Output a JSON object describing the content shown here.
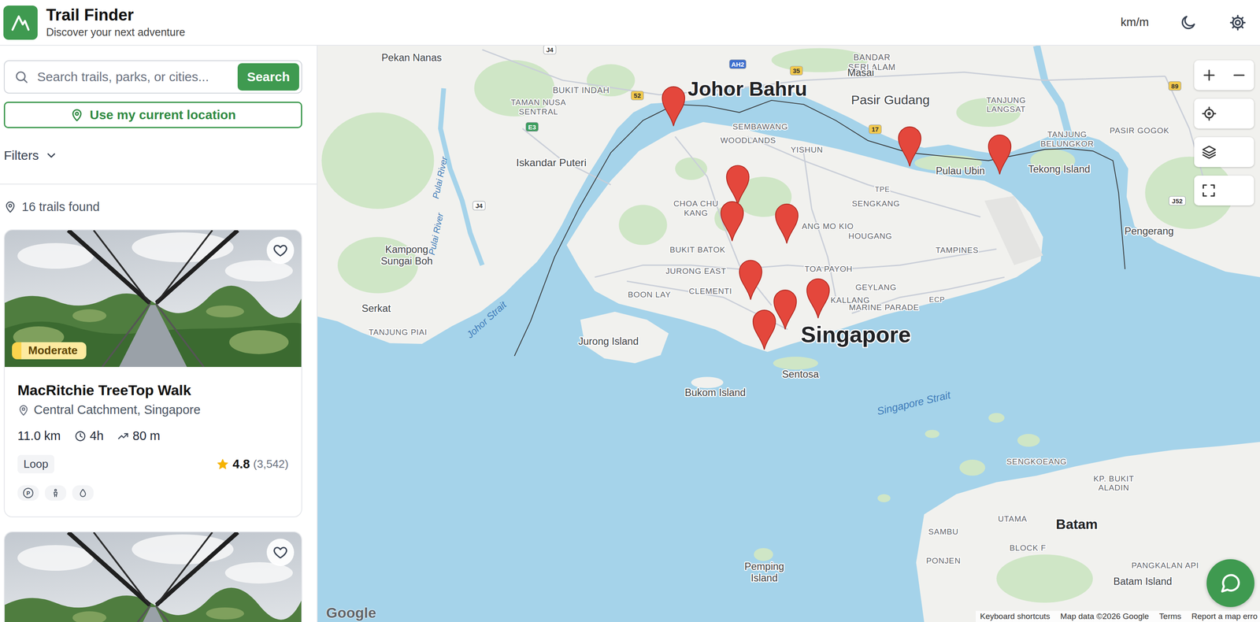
{
  "app": {
    "title": "Trail Finder",
    "subtitle": "Discover your next adventure"
  },
  "header": {
    "units": "km/m"
  },
  "search": {
    "placeholder": "Search trails, parks, or cities...",
    "button": "Search"
  },
  "location_button": "Use my current location",
  "filters": {
    "label": "Filters",
    "expanded": false
  },
  "results": {
    "count": "16 trails found"
  },
  "trails": [
    {
      "difficulty": "Moderate",
      "favorite": false,
      "name": "MacRitchie TreeTop Walk",
      "location": "Central Catchment, Singapore",
      "distance": "11.0 km",
      "duration": "4h",
      "elevation": "80 m",
      "type": "Loop",
      "rating": "4.8",
      "reviews": "(3,542)",
      "amenities": [
        {
          "kind": "parking",
          "label": "P"
        },
        {
          "kind": "restroom"
        },
        {
          "kind": "water"
        }
      ]
    },
    {
      "favorite": false
    }
  ],
  "map": {
    "labels": [
      {
        "lines": [
          "Pekan Nanas"
        ],
        "kind": "town"
      },
      {
        "lines": [
          "BUKIT INDAH"
        ],
        "kind": "district"
      },
      {
        "lines": [
          "Johor Bahru"
        ],
        "kind": "city"
      },
      {
        "lines": [
          "BANDAR",
          "SERI ALAM"
        ],
        "kind": "district"
      },
      {
        "lines": [
          "Masai"
        ],
        "kind": "town"
      },
      {
        "lines": [
          "Pasir Gudang"
        ],
        "kind": "town"
      },
      {
        "lines": [
          "TAMAN NUSA",
          "SENTRAL"
        ],
        "kind": "district"
      },
      {
        "lines": [
          "SEMBAWANG"
        ],
        "kind": "district"
      },
      {
        "lines": [
          "WOODLANDS"
        ],
        "kind": "district"
      },
      {
        "lines": [
          "YISHUN"
        ],
        "kind": "district"
      },
      {
        "lines": [
          "Iskandar Puteri"
        ],
        "kind": "town"
      },
      {
        "lines": [
          "Pulau Ubin"
        ],
        "kind": "town"
      },
      {
        "lines": [
          "Tekong Island"
        ],
        "kind": "town"
      },
      {
        "lines": [
          "TANJUNG",
          "LANGSAT"
        ],
        "kind": "district"
      },
      {
        "lines": [
          "TANJUNG",
          "BELUNGKOR"
        ],
        "kind": "district"
      },
      {
        "lines": [
          "PASIR GOGOK"
        ],
        "kind": "district"
      },
      {
        "lines": [
          "CHOA CHU",
          "KANG"
        ],
        "kind": "district"
      },
      {
        "lines": [
          "SENGKANG"
        ],
        "kind": "district"
      },
      {
        "lines": [
          "TPE"
        ],
        "kind": "district"
      },
      {
        "lines": [
          "BUKIT BATOK"
        ],
        "kind": "district"
      },
      {
        "lines": [
          "ANG MO KIO"
        ],
        "kind": "district"
      },
      {
        "lines": [
          "HOUGANG"
        ],
        "kind": "district"
      },
      {
        "lines": [
          "TAMPINES"
        ],
        "kind": "district"
      },
      {
        "lines": [
          "Pengerang"
        ],
        "kind": "town"
      },
      {
        "lines": [
          "Kampong",
          "Sungai Boh"
        ],
        "kind": "town"
      },
      {
        "lines": [
          "JURONG EAST"
        ],
        "kind": "district"
      },
      {
        "lines": [
          "TOA PAYOH"
        ],
        "kind": "district"
      },
      {
        "lines": [
          "BOON LAY"
        ],
        "kind": "district"
      },
      {
        "lines": [
          "CLEMENTI"
        ],
        "kind": "district"
      },
      {
        "lines": [
          "GEYLANG"
        ],
        "kind": "district"
      },
      {
        "lines": [
          "KALLANG"
        ],
        "kind": "district"
      },
      {
        "lines": [
          "MARINE PARADE"
        ],
        "kind": "district"
      },
      {
        "lines": [
          "ECP"
        ],
        "kind": "district"
      },
      {
        "lines": [
          "Singapore"
        ],
        "kind": "city"
      },
      {
        "lines": [
          "Serkat"
        ],
        "kind": "town"
      },
      {
        "lines": [
          "TANJUNG PIAI"
        ],
        "kind": "district"
      },
      {
        "lines": [
          "Johor Strait"
        ],
        "kind": "water"
      },
      {
        "lines": [
          "Jurong Island"
        ],
        "kind": "town"
      },
      {
        "lines": [
          "Sentosa"
        ],
        "kind": "town"
      },
      {
        "lines": [
          "Bukom Island"
        ],
        "kind": "town"
      },
      {
        "lines": [
          "Singapore Strait"
        ],
        "kind": "water"
      },
      {
        "lines": [
          "SENGKOEANG"
        ],
        "kind": "district"
      },
      {
        "lines": [
          "KP. BUKIT",
          "ALADIN"
        ],
        "kind": "district"
      },
      {
        "lines": [
          "SAMBU"
        ],
        "kind": "district"
      },
      {
        "lines": [
          "UTAMA"
        ],
        "kind": "district"
      },
      {
        "lines": [
          "Batam"
        ],
        "kind": "city"
      },
      {
        "lines": [
          "BLOCK F"
        ],
        "kind": "district"
      },
      {
        "lines": [
          "PONJEN"
        ],
        "kind": "district"
      },
      {
        "lines": [
          "PANGKALAN API"
        ],
        "kind": "district"
      },
      {
        "lines": [
          "Pemping",
          "Island"
        ],
        "kind": "town"
      },
      {
        "lines": [
          "Batam Island"
        ],
        "kind": "town"
      },
      {
        "lines": [
          "Pulai River"
        ],
        "kind": "water"
      },
      {
        "lines": [
          "Pulai River"
        ],
        "kind": "water"
      }
    ],
    "shields": [
      {
        "text": "AH2",
        "color": "#3d6fcf"
      },
      {
        "text": "35",
        "color": "#f2c94c"
      },
      {
        "text": "J4",
        "color": "#ffffff"
      },
      {
        "text": "52",
        "color": "#f2c94c"
      },
      {
        "text": "E3",
        "color": "#3c9d5d"
      },
      {
        "text": "J4",
        "color": "#ffffff"
      },
      {
        "text": "17",
        "color": "#f2c94c"
      },
      {
        "text": "89",
        "color": "#f2c94c"
      },
      {
        "text": "J52",
        "color": "#ffffff"
      }
    ],
    "logo": "Google",
    "attribution": [
      "Keyboard shortcuts",
      "Map data ©2026 Google",
      "Terms",
      "Report a map erro"
    ]
  }
}
